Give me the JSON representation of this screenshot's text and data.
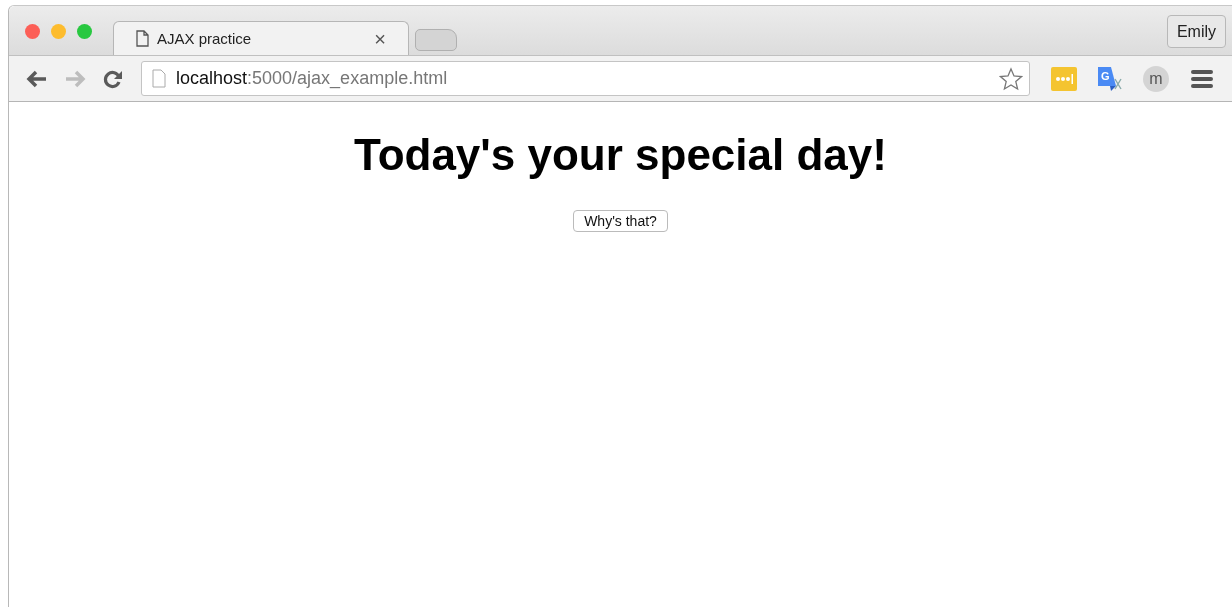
{
  "tabs": [
    {
      "title": "AJAX practice",
      "selected": true,
      "close": "×"
    }
  ],
  "profile": {
    "name": "Emily"
  },
  "nav": [
    {
      "kind": "back",
      "disabled": false
    },
    {
      "kind": "forward",
      "disabled": true
    },
    {
      "kind": "reload",
      "disabled": false
    }
  ],
  "address_bar": {
    "host": "localhost",
    "path": ":5000/ajax_example.html",
    "bookmarked": false
  },
  "extensions": [
    {
      "kind": "lastpass"
    },
    {
      "kind": "translate",
      "glyph": "G"
    },
    {
      "kind": "avatar",
      "glyph": "m"
    }
  ],
  "page": {
    "heading": "Today's your special day!",
    "button": "Why's that?"
  }
}
